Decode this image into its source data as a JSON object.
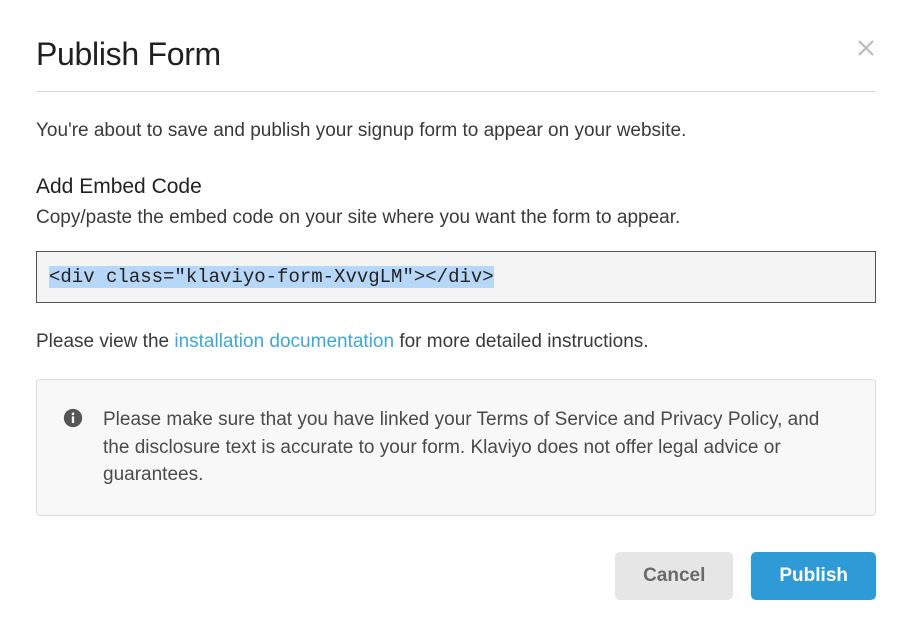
{
  "modal": {
    "title": "Publish Form",
    "intro": "You're about to save and publish your signup form to appear on your website.",
    "embed": {
      "heading": "Add Embed Code",
      "sub": "Copy/paste the embed code on your site where you want the form to appear.",
      "code": "<div class=\"klaviyo-form-XvvgLM\"></div>"
    },
    "install": {
      "prefix": "Please view the ",
      "link_text": "installation documentation",
      "suffix": " for more detailed instructions."
    },
    "notice": "Please make sure that you have linked your Terms of Service and Privacy Policy, and the disclosure text is accurate to your form. Klaviyo does not offer legal advice or guarantees.",
    "buttons": {
      "cancel": "Cancel",
      "publish": "Publish"
    }
  }
}
